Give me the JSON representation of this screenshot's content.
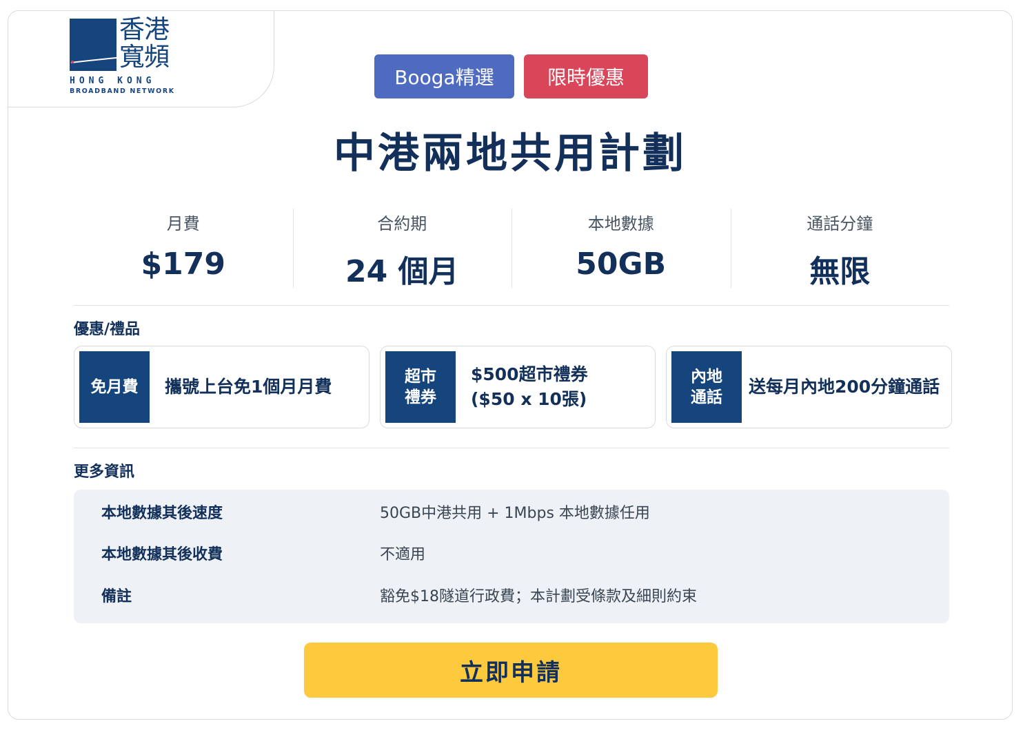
{
  "logo": {
    "chinese_name": "香港寬頻",
    "english_line1": "HONG KONG",
    "english_line2": "BROADBAND NETWORK"
  },
  "badges": [
    "Booga精選",
    "限時優惠"
  ],
  "title": "中港兩地共用計劃",
  "stats": [
    {
      "label": "月費",
      "value": "$179"
    },
    {
      "label": "合約期",
      "value": "24 個月"
    },
    {
      "label": "本地數據",
      "value": "50GB"
    },
    {
      "label": "通話分鐘",
      "value": "無限"
    }
  ],
  "offers_section": {
    "title": "優惠/禮品",
    "items": [
      {
        "tag": "免月費",
        "text_line1": "攜號上台免1個月月費",
        "text_line2": ""
      },
      {
        "tag": "超市\n禮券",
        "text_line1": "$500超市禮券",
        "text_line2": "($50 x 10張)"
      },
      {
        "tag": "內地\n通話",
        "text_line1": "送每月內地200分鐘通話",
        "text_line2": ""
      }
    ]
  },
  "info_section": {
    "title": "更多資訊",
    "rows": [
      {
        "key": "本地數據其後速度",
        "value": "50GB中港共用 + 1Mbps 本地數據任用"
      },
      {
        "key": "本地數據其後收費",
        "value": "不適用"
      },
      {
        "key": "備註",
        "value": "豁免$18隧道行政費；本計劃受條款及細則約束"
      }
    ]
  },
  "cta": {
    "label": "立即申請"
  },
  "colors": {
    "brand_blue": "#16457e",
    "title_navy": "#12305a",
    "badge_blue": "#4e6bbf",
    "badge_red": "#d9465a",
    "cta_yellow": "#fdc93d"
  }
}
